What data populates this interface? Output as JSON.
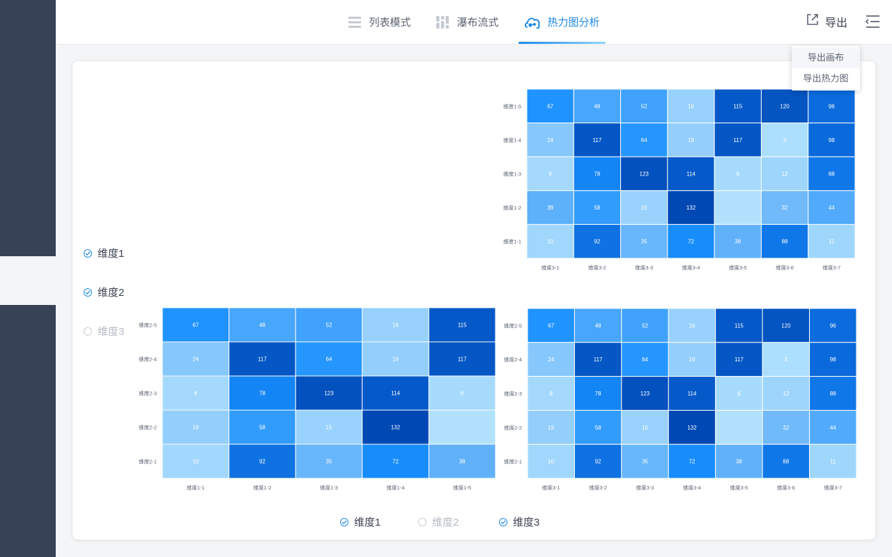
{
  "tabs": [
    {
      "label": "列表模式",
      "icon": "list-icon",
      "active": false
    },
    {
      "label": "瀑布流式",
      "icon": "waterfall-icon",
      "active": false
    },
    {
      "label": "热力图分析",
      "icon": "heatmap-icon",
      "active": true
    }
  ],
  "export": {
    "label": "导出"
  },
  "dropdown": {
    "items": [
      "导出画布",
      "导出热力图"
    ]
  },
  "side_legend": [
    {
      "label": "维度1",
      "checked": true
    },
    {
      "label": "维度2",
      "checked": true
    },
    {
      "label": "维度3",
      "checked": false
    }
  ],
  "bottom_legend": [
    {
      "label": "维度1",
      "checked": true
    },
    {
      "label": "维度2",
      "checked": false
    },
    {
      "label": "维度3",
      "checked": true
    }
  ],
  "colors": {
    "accent": "#1e89e8",
    "sidebar": "#374256",
    "heat_low": "#b1e1fd",
    "heat_high": "#0054bc"
  },
  "chart_data": [
    {
      "type": "heatmap",
      "x_categories": [
        "维度3-1",
        "维度3-2",
        "维度3-3",
        "维度3-4",
        "维度3-5",
        "维度3-6",
        "维度3-7"
      ],
      "y_categories": [
        "维度1-5",
        "维度1-4",
        "维度1-3",
        "维度1-2",
        "维度1-1"
      ],
      "values": [
        [
          67,
          48,
          52,
          16,
          115,
          120,
          96
        ],
        [
          24,
          117,
          64,
          19,
          117,
          3,
          98
        ],
        [
          8,
          78,
          123,
          114,
          6,
          12,
          88
        ],
        [
          39,
          58,
          15,
          132,
          "",
          32,
          44
        ],
        [
          10,
          92,
          35,
          72,
          38,
          88,
          11
        ]
      ]
    },
    {
      "type": "heatmap",
      "x_categories": [
        "维度1-1",
        "维度1-2",
        "维度1-3",
        "维度1-4",
        "维度1-5"
      ],
      "y_categories": [
        "维度2-5",
        "维度2-4",
        "维度2-3",
        "维度2-2",
        "维度2-1"
      ],
      "values": [
        [
          67,
          48,
          52,
          16,
          115
        ],
        [
          24,
          117,
          64,
          19,
          117
        ],
        [
          8,
          78,
          123,
          114,
          6
        ],
        [
          19,
          58,
          15,
          132,
          ""
        ],
        [
          10,
          92,
          35,
          72,
          38
        ]
      ]
    },
    {
      "type": "heatmap",
      "x_categories": [
        "维度3-1",
        "维度3-2",
        "维度3-3",
        "维度3-4",
        "维度3-5",
        "维度3-6",
        "维度3-7"
      ],
      "y_categories": [
        "维度2-5",
        "维度2-4",
        "维度2-3",
        "维度2-2",
        "维度2-1"
      ],
      "values": [
        [
          67,
          48,
          52,
          16,
          115,
          120,
          96
        ],
        [
          24,
          117,
          64,
          19,
          117,
          3,
          98
        ],
        [
          8,
          78,
          123,
          114,
          6,
          12,
          88
        ],
        [
          19,
          58,
          15,
          132,
          "",
          32,
          44
        ],
        [
          10,
          92,
          35,
          72,
          38,
          88,
          11
        ]
      ]
    }
  ]
}
